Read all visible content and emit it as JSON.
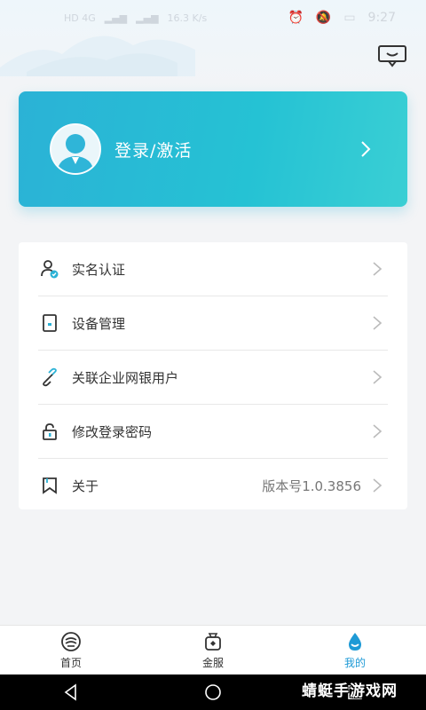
{
  "status_bar": {
    "network_left": "HD 4G",
    "speed": "16.3 K/s",
    "time": "9:27"
  },
  "header": {
    "message_icon": "message-icon"
  },
  "login_card": {
    "label": "登录/激活",
    "avatar_icon": "avatar-icon",
    "gradient_start": "#2bb2d6",
    "gradient_end": "#3acfd4"
  },
  "menu": {
    "items": [
      {
        "label": "实名认证",
        "icon": "person-verified-icon",
        "value": ""
      },
      {
        "label": "设备管理",
        "icon": "device-icon",
        "value": ""
      },
      {
        "label": "关联企业网银用户",
        "icon": "link-icon",
        "value": ""
      },
      {
        "label": "修改登录密码",
        "icon": "lock-icon",
        "value": ""
      },
      {
        "label": "关于",
        "icon": "bookmark-icon",
        "value": "版本号1.0.3856"
      }
    ]
  },
  "tab_bar": {
    "active_color": "#1e9ad6",
    "tabs": [
      {
        "label": "首页",
        "icon": "home-icon"
      },
      {
        "label": "金服",
        "icon": "money-bag-icon"
      },
      {
        "label": "我的",
        "icon": "drop-icon",
        "active": true
      }
    ]
  },
  "watermark": "蜻蜓手游戏网"
}
